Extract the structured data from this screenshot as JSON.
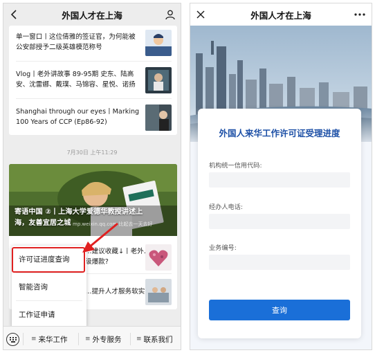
{
  "left": {
    "header": {
      "title": "外国人才在上海",
      "back_icon": "chevron-left-icon",
      "profile_icon": "user-icon"
    },
    "articles": [
      {
        "title": "单一窗口丨这位倩雅的签证官，为何能被公安部授予二级英雄模范称号"
      },
      {
        "title": "Vlog丨老外讲故事 89-95期 史东、陆高安、沈雷娜、戴璞、马锦容、星悦、诺扬"
      },
      {
        "title": "Shanghai through our eyes丨Marking 100 Years of CCP (Ep86-92)"
      }
    ],
    "timestamp": "7月30日 上午11:29",
    "feature": {
      "caption": "寄语中国 ②丨上海大学爱德华教授讲述上海，友善宜居之城",
      "watermark": "mp.weixin.qq.com 比起去一天去好"
    },
    "hidden_articles": [
      {
        "title": "…建议收藏↓丨老外…级爆款?"
      },
      {
        "title": "…提升人才服务软实"
      }
    ],
    "popup_menu": {
      "items": [
        {
          "label": "许可证进度查询",
          "highlighted": true
        },
        {
          "label": "智能咨询",
          "highlighted": false
        },
        {
          "label": "工作证申请",
          "highlighted": false
        }
      ],
      "highlight_color": "#e02020"
    },
    "bottom_bar": {
      "keyboard_icon": "keyboard-icon",
      "tabs": [
        {
          "label": "来华工作"
        },
        {
          "label": "外专服务"
        },
        {
          "label": "联系我们"
        }
      ]
    }
  },
  "right": {
    "header": {
      "title": "外国人才在上海",
      "close_icon": "close-icon",
      "more_icon": "more-dots-icon"
    },
    "form": {
      "title": "外国人来华工作许可证受理进度",
      "fields": [
        {
          "label": "机构统一信用代码:",
          "value": ""
        },
        {
          "label": "经办人电话:",
          "value": ""
        },
        {
          "label": "业务编号:",
          "value": ""
        }
      ],
      "submit_label": "查询",
      "accent_color": "#1a6fd8",
      "title_color": "#1c4fa6"
    }
  }
}
